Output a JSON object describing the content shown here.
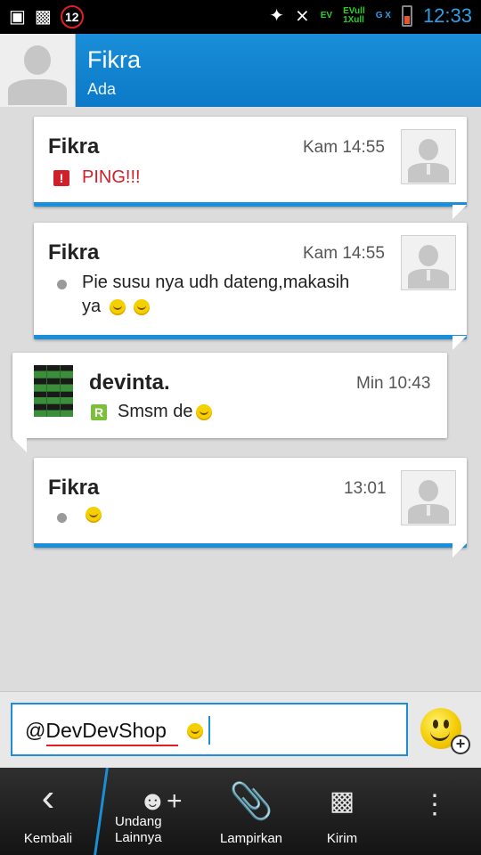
{
  "status_bar": {
    "time": "12:33",
    "notification_count": "12",
    "network_1": "EV",
    "network_2": "EVull",
    "network_3": "1Xull",
    "network_4": "G X"
  },
  "header": {
    "contact_name": "Fikra",
    "contact_status": "Ada"
  },
  "messages": [
    {
      "sender": "Fikra",
      "time": "Kam 14:55",
      "text": "PING!!!",
      "type": "ping"
    },
    {
      "sender": "Fikra",
      "time": "Kam 14:55",
      "text_line1": "Pie susu nya udh dateng,makasih",
      "text_line2": "ya",
      "type": "normal"
    },
    {
      "sender": "devinta.",
      "time": "Min 10:43",
      "text": "Smsm de",
      "type": "read"
    },
    {
      "sender": "Fikra",
      "time": "13:01",
      "text": "",
      "type": "normal"
    }
  ],
  "compose": {
    "value": "@DevDevShop"
  },
  "bottom_bar": {
    "back": "Kembali",
    "invite_line1": "Undang",
    "invite_line2": "Lainnya",
    "attach": "Lampirkan",
    "send": "Kirim"
  },
  "colors": {
    "accent": "#1a8ed8",
    "ping": "#d0202a",
    "read": "#7bbf3a"
  }
}
